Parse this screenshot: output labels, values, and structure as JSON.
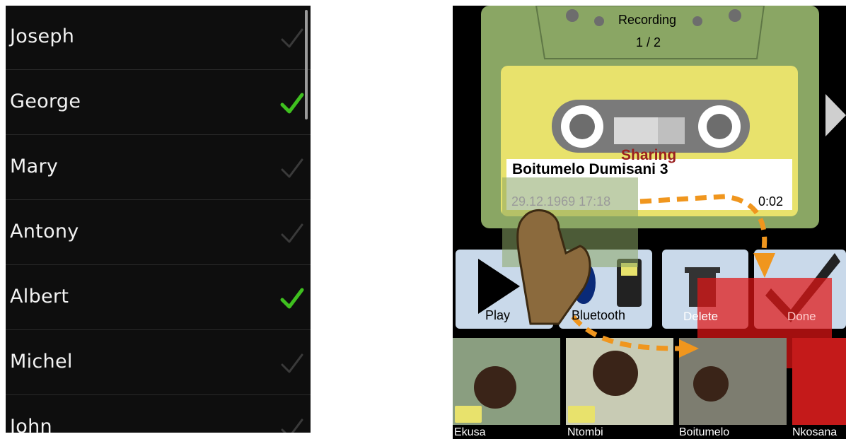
{
  "left_list": {
    "items": [
      {
        "name": "Joseph",
        "checked": false
      },
      {
        "name": "George",
        "checked": true
      },
      {
        "name": "Mary",
        "checked": false
      },
      {
        "name": "Antony",
        "checked": false
      },
      {
        "name": "Albert",
        "checked": true
      },
      {
        "name": "Michel",
        "checked": false
      },
      {
        "name": "John",
        "checked": false
      }
    ]
  },
  "recorder": {
    "cassette_title": "Recording",
    "counter": "1 / 2",
    "recording_name": "Boitumelo Dumisani 3",
    "date": "29.12.1969 17:18",
    "duration": "0:02",
    "sharing_label": "Sharing"
  },
  "buttons": {
    "play": "Play",
    "bluetooth": "Bluetooth",
    "delete": "Delete",
    "done": "Done"
  },
  "contacts": [
    {
      "name": "Ekusa"
    },
    {
      "name": "Ntombi"
    },
    {
      "name": "Boitumelo"
    },
    {
      "name": "Nkosana"
    }
  ],
  "colors": {
    "check_on": "#3fc01f",
    "cassette_green": "#8aa664",
    "label_yellow": "#e8e26c",
    "button_blue": "#c9d9ea",
    "arrow_orange": "#f0961e",
    "share_red": "#e01515"
  }
}
